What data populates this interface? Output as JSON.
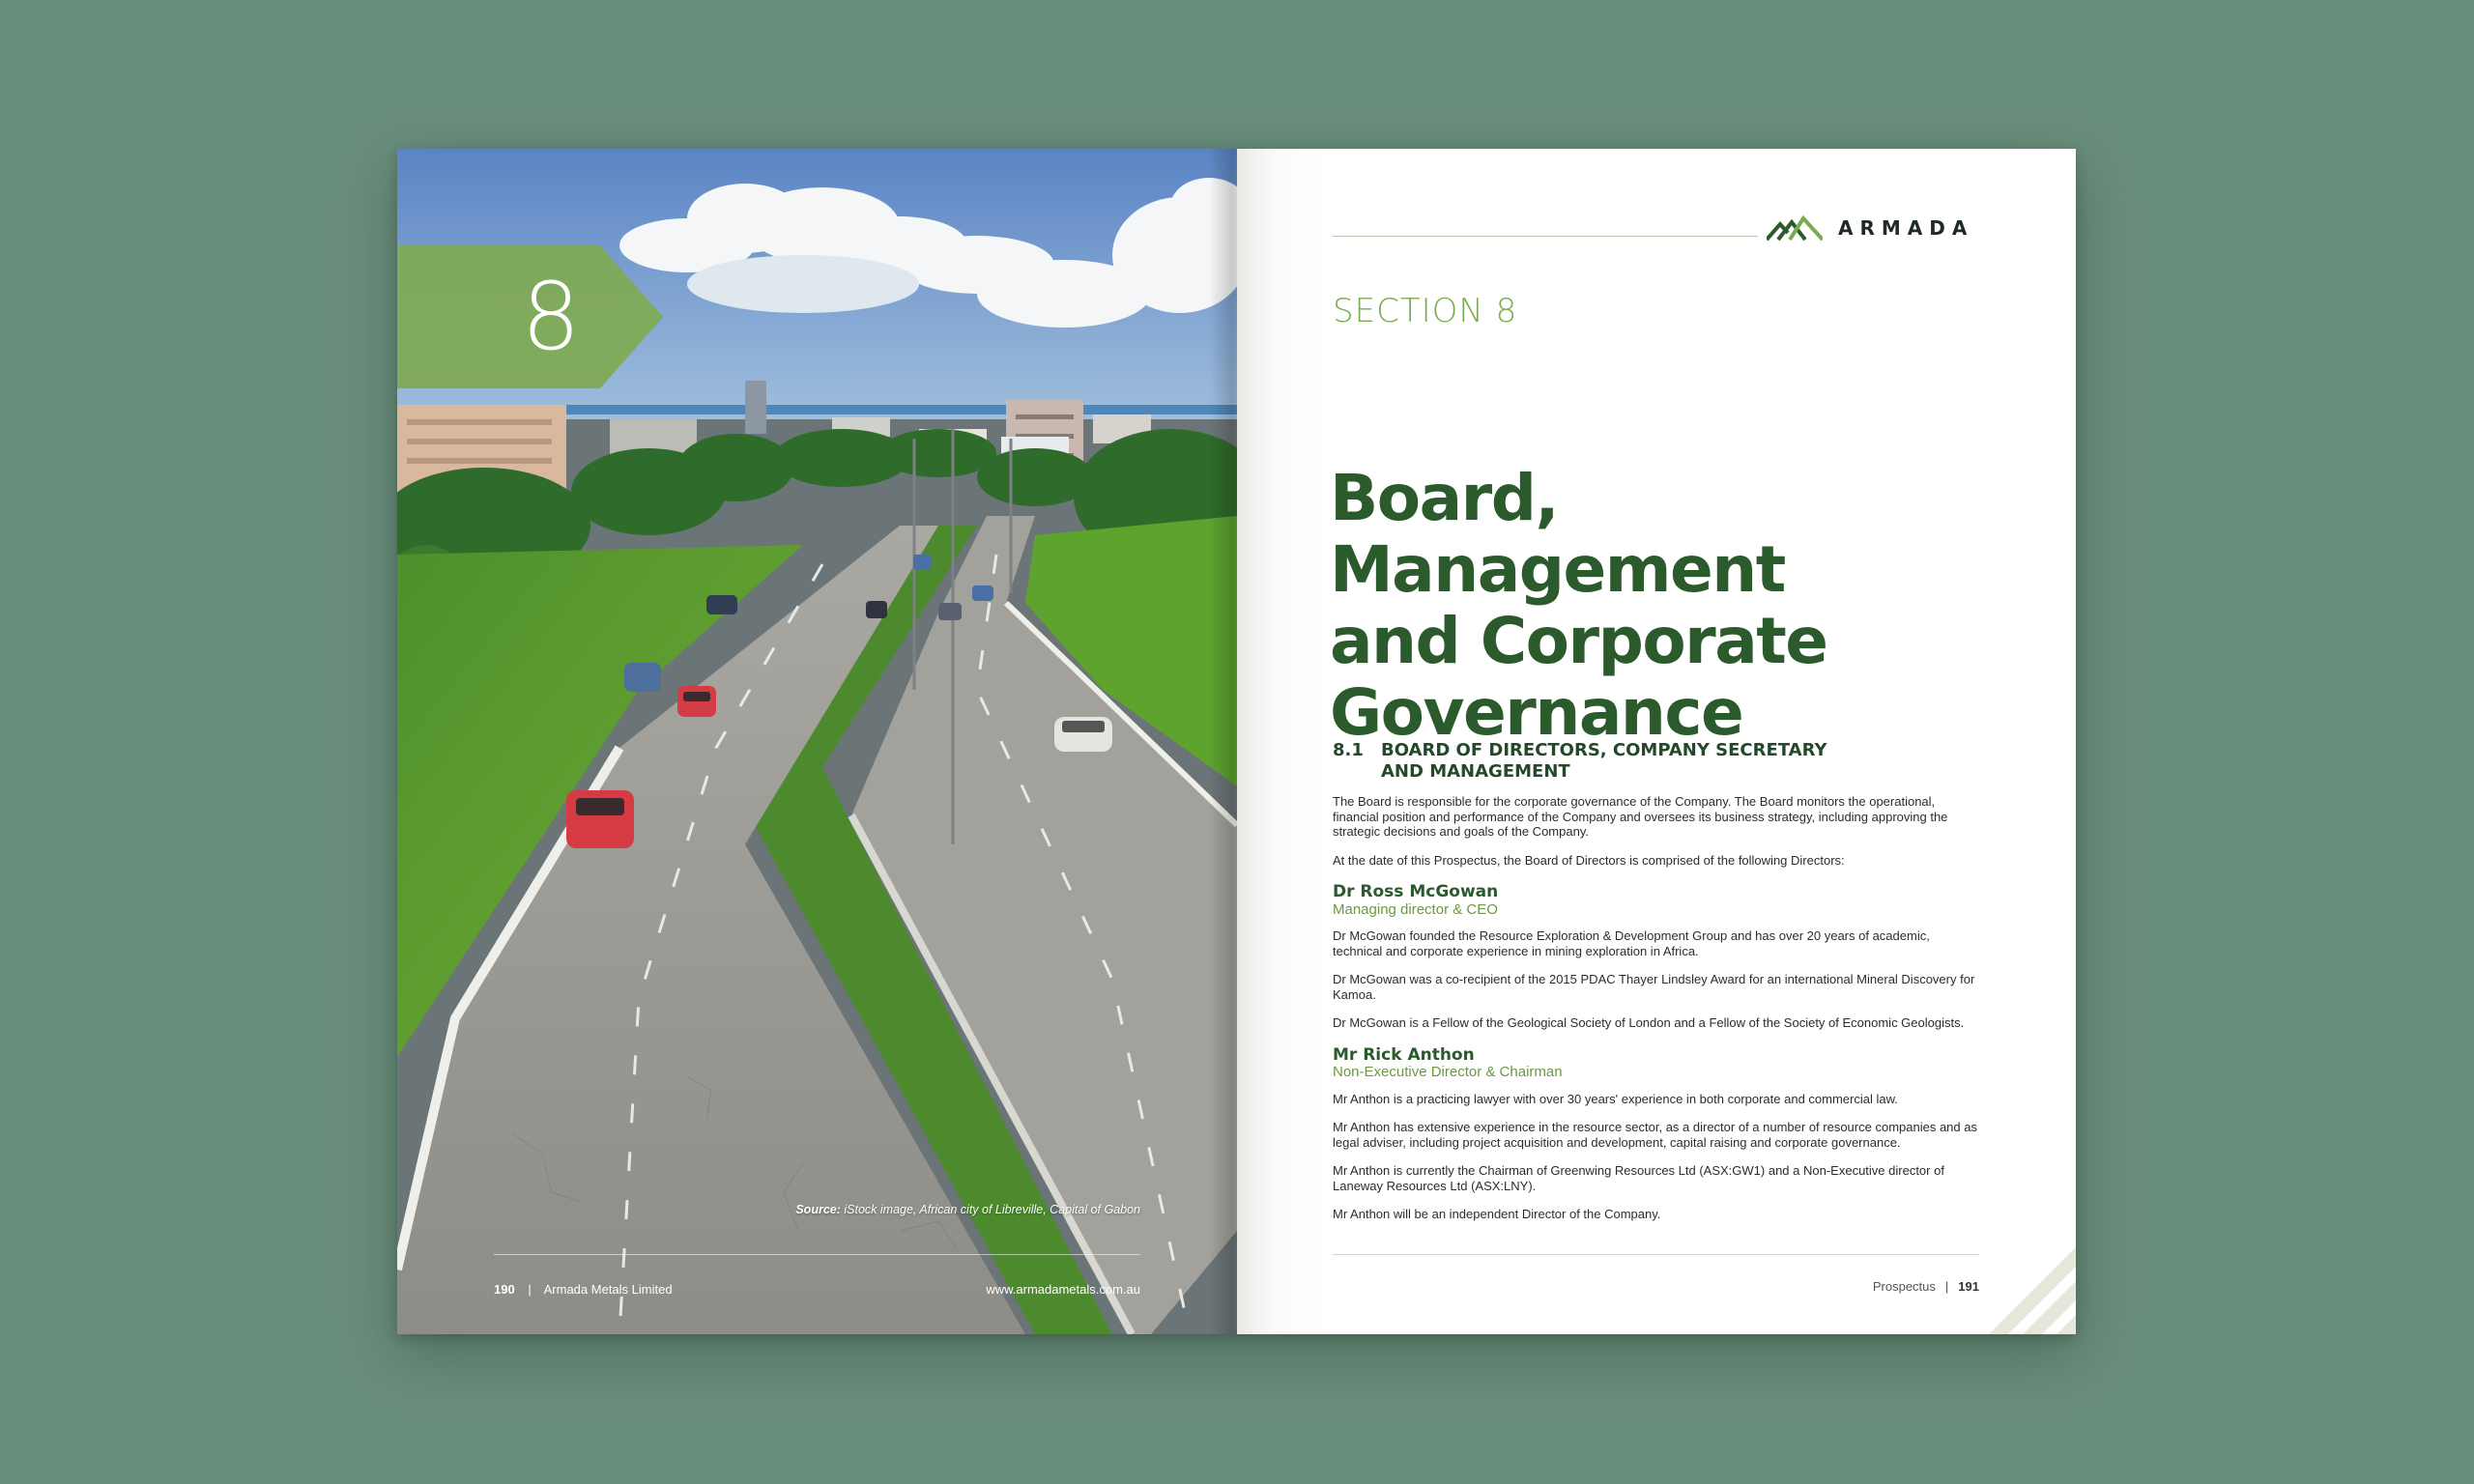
{
  "left_page": {
    "section_number": "8",
    "caption_source_label": "Source:",
    "caption_source_text": "iStock image, African city of Libreville, Capital of Gabon",
    "footer_page_number": "190",
    "footer_separator": "|",
    "footer_company": "Armada Metals Limited",
    "footer_website": "www.armadametals.com.au"
  },
  "right_page": {
    "brand_name": "ARMADA",
    "section_label": "SECTION 8",
    "title_lines": [
      "Board, Management",
      "and Corporate",
      "Governance"
    ],
    "subsection_number": "8.1",
    "subsection_title_line1": "BOARD OF DIRECTORS, COMPANY SECRETARY",
    "subsection_title_line2": "AND MANAGEMENT",
    "intro_paragraphs": [
      "The Board is responsible for the corporate governance of the Company. The Board monitors the operational, financial position and performance of the Company and oversees its business strategy, including approving the strategic decisions and goals of the Company.",
      "At the date of this Prospectus, the Board of Directors is comprised of the following Directors:"
    ],
    "directors": [
      {
        "name": "Dr Ross McGowan",
        "role": "Managing director & CEO",
        "paragraphs": [
          "Dr McGowan founded the Resource Exploration & Development Group and has over 20 years of academic, technical and corporate experience in mining exploration in Africa.",
          "Dr McGowan was a co-recipient of the 2015 PDAC Thayer Lindsley Award for an international Mineral Discovery for Kamoa.",
          "Dr McGowan is a Fellow of the Geological Society of London and a Fellow of the Society of Economic Geologists."
        ]
      },
      {
        "name": "Mr Rick Anthon",
        "role": "Non-Executive Director & Chairman",
        "paragraphs": [
          "Mr Anthon is a practicing lawyer with over 30 years' experience in both corporate and commercial law.",
          "Mr Anthon has extensive experience in the resource sector, as a director of a number of resource companies and as legal adviser, including project acquisition and development, capital raising and corporate governance.",
          "Mr Anthon is currently the Chairman of Greenwing Resources Ltd (ASX:GW1) and a Non-Executive director of Laneway Resources Ltd (ASX:LNY).",
          "Mr Anthon will be an independent Director of the Company."
        ]
      }
    ],
    "footer_label": "Prospectus",
    "footer_separator": "|",
    "footer_page_number": "191"
  },
  "colors": {
    "background": "#6a8e7c",
    "brand_green_dark": "#2b5a2c",
    "brand_green_light": "#7aab4e"
  }
}
